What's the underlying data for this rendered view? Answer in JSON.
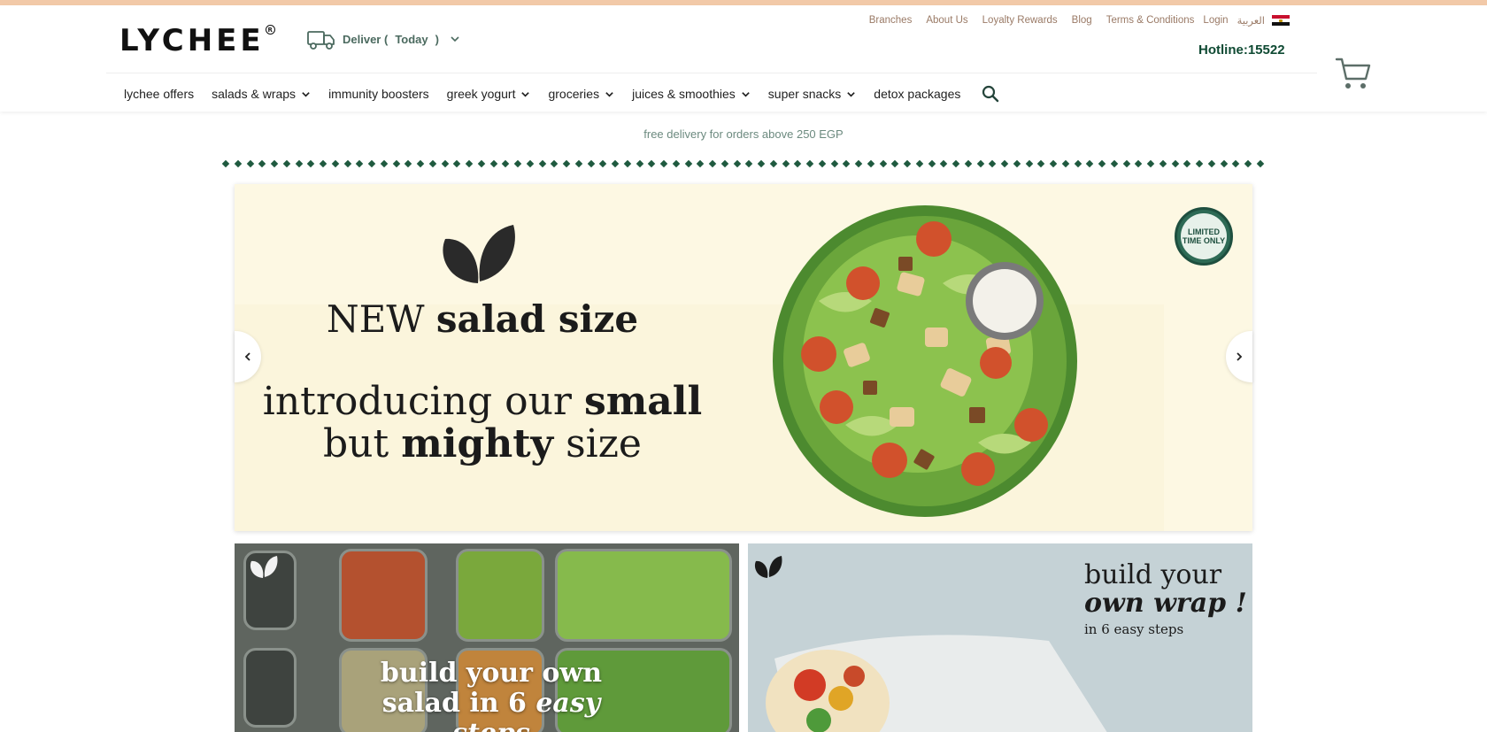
{
  "header": {
    "logo": "LYCHEE",
    "deliver_label": "Deliver (",
    "deliver_value": "Today",
    "deliver_close": ")",
    "hotline": "Hotline:15522",
    "top_links": [
      "Branches",
      "About Us",
      "Loyalty Rewards",
      "Blog",
      "Terms & Conditions",
      "Login",
      "العربية"
    ]
  },
  "nav": {
    "items": [
      {
        "label": "lychee offers",
        "dropdown": false
      },
      {
        "label": "salads & wraps",
        "dropdown": true
      },
      {
        "label": "immunity boosters",
        "dropdown": false
      },
      {
        "label": "greek yogurt",
        "dropdown": true
      },
      {
        "label": "groceries",
        "dropdown": true
      },
      {
        "label": "juices & smoothies",
        "dropdown": true
      },
      {
        "label": "super snacks",
        "dropdown": true
      },
      {
        "label": "detox packages",
        "dropdown": false
      }
    ]
  },
  "promo": "free delivery for orders above 250 EGP",
  "hero": {
    "line1_a": "NEW ",
    "line1_b": "salad size",
    "line2_a": "introducing our ",
    "line2_b": "small",
    "line3_a": "but ",
    "line3_b": "mighty",
    "line3_c": " size",
    "badge": "LIMITED TIME ONLY"
  },
  "tiles": {
    "salad": {
      "line1": "build your own",
      "line2_a": "salad in 6 ",
      "line2_b": "easy steps"
    },
    "wrap": {
      "line1": "build your",
      "line2": "own wrap !",
      "line3": "in 6 easy steps"
    }
  },
  "colors": {
    "brand_green": "#0f4a33",
    "top_strip": "#f2c9a8",
    "link_brown": "#9a7a66",
    "hero_bg": "#fdf8e3"
  }
}
